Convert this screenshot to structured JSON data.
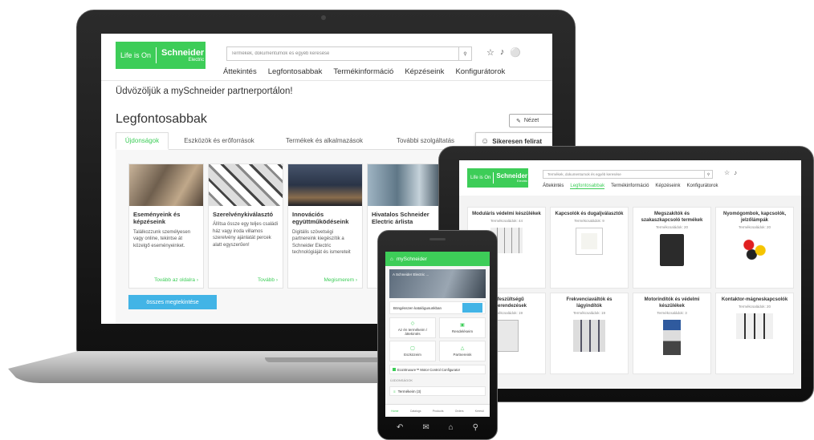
{
  "colors": {
    "brand": "#3dcd58",
    "button": "#42b4e6"
  },
  "laptop": {
    "logo": {
      "life_is_on": "Life is On",
      "brand": "Schneider",
      "sub": "Electric"
    },
    "search": {
      "placeholder": "Termékek, dokumentumok és egyéb keresése",
      "icon": "search-icon"
    },
    "header_icons": [
      "ribbon-icon",
      "bell-icon",
      "user-icon"
    ],
    "nav": [
      "Áttekintés",
      "Legfontosabbak",
      "Termékinformáció",
      "Képzéseink",
      "Konfigurátorok"
    ],
    "welcome": "Üdvözöljük a mySchneider partnerportálon!",
    "section_title": "Legfontosabbak",
    "view_button": "Nézet",
    "tabs": [
      "Újdonságok",
      "Eszközök és erőforrások",
      "Termékek és alkalmazások",
      "További szolgáltatás"
    ],
    "toast": "Sikeresen felirat",
    "cards": [
      {
        "title": "Eseményeink és képzéseink",
        "text": "Találkozzunk személyesen vagy online, tekintse át közelgő eseményeinket.",
        "link": "Tovább az oldalra"
      },
      {
        "title": "Szerelvénykiválasztó",
        "text": "Állítsa össze egy teljes családi ház vagy iroda villamos szerelvény ajánlatát percek alatt egyszerűen!",
        "link": "Tovább"
      },
      {
        "title": "Innovációs együttműködéseink",
        "text": "Digitális szövetségi partnereink kiegészítik a Schneider Electric technológiáját és ismereteit",
        "link": "Megismerem"
      },
      {
        "title": "Hivatalos Schneider Electric árlista",
        "text": "",
        "link": ""
      }
    ],
    "all_button": "összes megtekintése"
  },
  "tablet": {
    "search": {
      "placeholder": "Termékek, dokumentumok és egyéb keresése"
    },
    "nav": [
      "Áttekintés",
      "Legfontosabbak",
      "Termékinformáció",
      "Képzéseink",
      "Konfigurátorok"
    ],
    "active_nav": "Legfontosabbak",
    "products": [
      {
        "name": "Moduláris védelmi készülékek",
        "count": "Termékcsaládok: 44"
      },
      {
        "name": "Kapcsolók és dugaljválasztók",
        "count": "Termékcsaládok: 9"
      },
      {
        "name": "Megszakítók és szakaszkapcsoló termékek",
        "count": "Termékcsaládok: 20"
      },
      {
        "name": "Nyomógombok, kapcsolók, jelzőlámpák",
        "count": "Termékcsaládok: 20"
      },
      {
        "name": "...lofeszültségű ...lóberendezések",
        "count": "Termékcsaládok: 19"
      },
      {
        "name": "Frekvenciaváltók és lágyindítók",
        "count": "Termékcsaládok: 19"
      },
      {
        "name": "Motorindítók és védelmi készülékek",
        "count": "Termékcsaládok: 3"
      },
      {
        "name": "Kontaktor-mágneskapcsolók",
        "count": "Termékcsaládok: 20"
      }
    ]
  },
  "phone": {
    "app_title": "mySchneider",
    "banner_text": "A Schneider Electric ...",
    "catalog_text": "Böngésszen katalógusunkban",
    "tiles": [
      "Az én termékeim / áttekintés",
      "Rendeléseim",
      "Eszközeim",
      "Partnereink"
    ],
    "configurator": "EcoStruxure™ Motor Control Configurator",
    "section_label": "ÚJDONSÁGOK",
    "products_row": "Termékeim (3)",
    "bottom_tabs": [
      "Home",
      "Catalogs",
      "Products",
      "Orders",
      "Kereső"
    ]
  }
}
